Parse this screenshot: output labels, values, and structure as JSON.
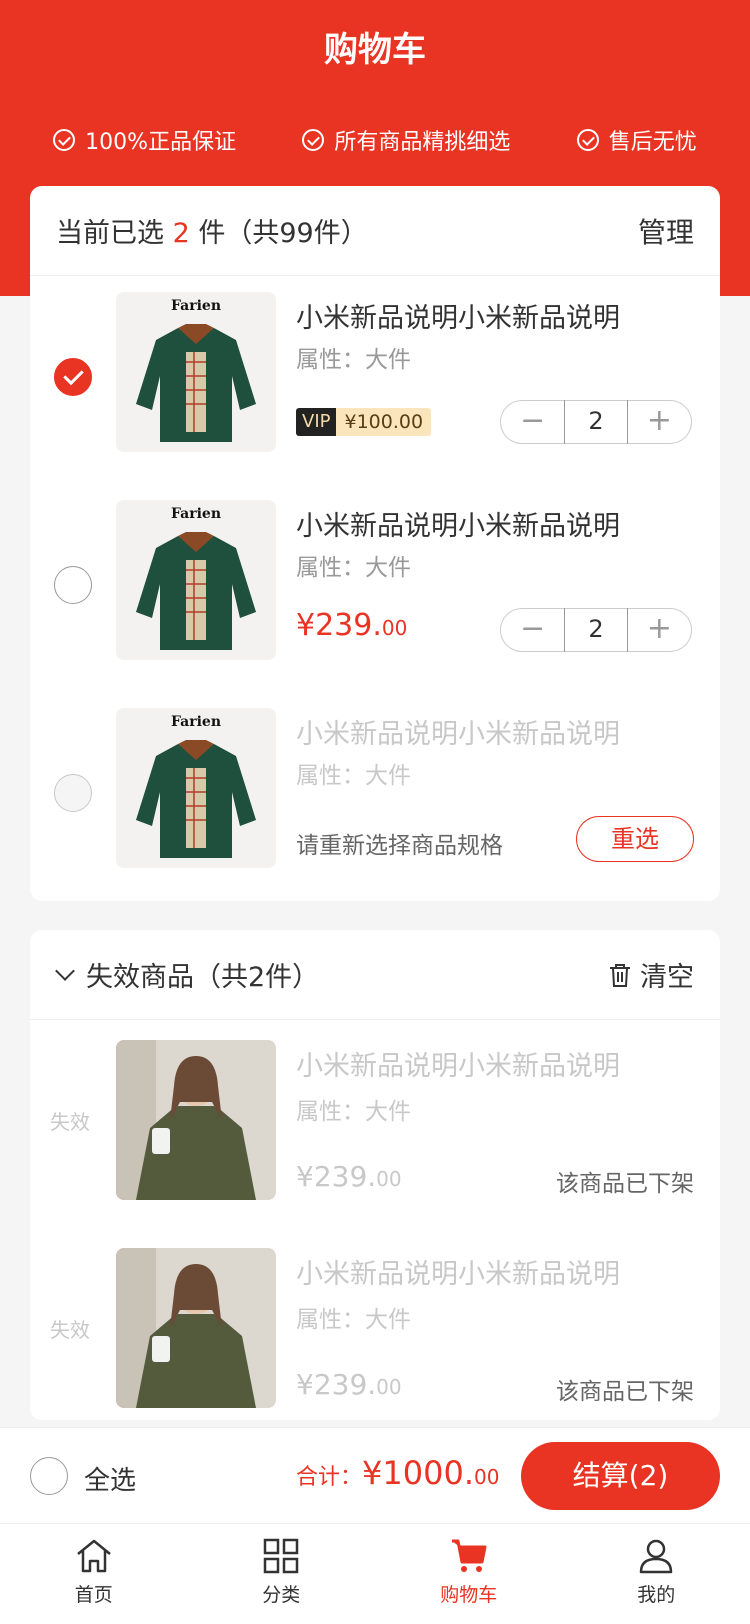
{
  "header": {
    "title": "购物车",
    "guarantees": [
      "100%正品保证",
      "所有商品精挑细选",
      "售后无忧"
    ]
  },
  "cart": {
    "summary_prefix": "当前已选",
    "selected_count": "2",
    "summary_suffix": "件（共99件）",
    "manage_label": "管理",
    "items": [
      {
        "title": "小米新品说明小米新品说明",
        "attr": "属性：大件",
        "checked": true,
        "vip_badge": "VIP",
        "vip_price": "¥100.00",
        "quantity": "2",
        "minus": "−",
        "plus": "+"
      },
      {
        "title": "小米新品说明小米新品说明",
        "attr": "属性：大件",
        "checked": false,
        "price_int": "¥239.",
        "price_cents": "00",
        "quantity": "2",
        "minus": "−",
        "plus": "+"
      },
      {
        "title": "小米新品说明小米新品说明",
        "attr": "属性：大件",
        "checked": false,
        "disabled": true,
        "reselect_text": "请重新选择商品规格",
        "reselect_button": "重选"
      }
    ]
  },
  "invalid": {
    "title": "失效商品（共2件）",
    "clear_label": "清空",
    "items": [
      {
        "tag": "失效",
        "title": "小米新品说明小米新品说明",
        "attr": "属性：大件",
        "price_int": "¥239.",
        "price_cents": "00",
        "status": "该商品已下架"
      },
      {
        "tag": "失效",
        "title": "小米新品说明小米新品说明",
        "attr": "属性：大件",
        "price_int": "¥239.",
        "price_cents": "00",
        "status": "该商品已下架"
      }
    ]
  },
  "checkout": {
    "select_all": "全选",
    "total_label": "合计：",
    "total_int": "¥1000.",
    "total_cents": "00",
    "button": "结算(2)"
  },
  "tabbar": {
    "items": [
      {
        "label": "首页",
        "icon": "home-icon"
      },
      {
        "label": "分类",
        "icon": "category-icon"
      },
      {
        "label": "购物车",
        "icon": "cart-icon",
        "active": true
      },
      {
        "label": "我的",
        "icon": "user-icon"
      }
    ]
  },
  "colors": {
    "brand": "#e93323",
    "vip_bg": "#222222",
    "vip_price_bg": "#fbe5bd"
  }
}
